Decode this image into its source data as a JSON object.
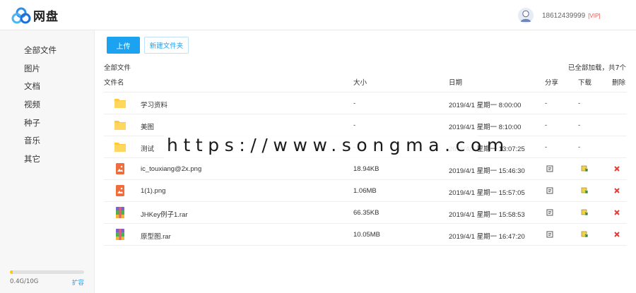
{
  "app": {
    "logo_text": "网盘"
  },
  "user": {
    "phone": "18612439999",
    "vip": "[VIP]"
  },
  "sidebar": {
    "items": [
      {
        "label": "全部文件"
      },
      {
        "label": "图片"
      },
      {
        "label": "文档"
      },
      {
        "label": "视频"
      },
      {
        "label": "种子"
      },
      {
        "label": "音乐"
      },
      {
        "label": "其它"
      }
    ],
    "storage": {
      "text": "0.4G/10G",
      "used_fraction": 0.04,
      "expand_label": "扩容"
    }
  },
  "toolbar": {
    "upload_label": "上传",
    "new_folder_label": "新建文件夹"
  },
  "breadcrumb": "全部文件",
  "status": "已全部加载，共7个",
  "table": {
    "headers": {
      "name": "文件名",
      "size": "大小",
      "date": "日期",
      "share": "分享",
      "download": "下载",
      "delete": "删除"
    },
    "rows": [
      {
        "type": "folder",
        "name": "学习资料",
        "size": "-",
        "date": "2019/4/1 星期一 8:00:00",
        "share": "-",
        "download": "-"
      },
      {
        "type": "folder",
        "name": "美图",
        "size": "-",
        "date": "2019/4/1 星期一 8:10:00",
        "share": "-",
        "download": "-"
      },
      {
        "type": "folder",
        "name": "测试",
        "size": "-",
        "date": "2019/4/1 星期一 13:07:25",
        "share": "-",
        "download": "-"
      },
      {
        "type": "image",
        "name": "ic_touxiang@2x.png",
        "size": "18.94KB",
        "date": "2019/4/1 星期一 15:46:30"
      },
      {
        "type": "image",
        "name": "1(1).png",
        "size": "1.06MB",
        "date": "2019/4/1 星期一 15:57:05"
      },
      {
        "type": "archive",
        "name": "JHKey例子1.rar",
        "size": "66.35KB",
        "date": "2019/4/1 星期一 15:58:53"
      },
      {
        "type": "archive",
        "name": "原型图.rar",
        "size": "10.05MB",
        "date": "2019/4/1 星期一 16:47:20"
      }
    ]
  },
  "watermark": "https://www.songma.com",
  "colors": {
    "accent": "#1ba2f0",
    "folder": "#ffc93c",
    "image_file": "#f26b3a",
    "delete": "#e53935",
    "storage_bar": "#ffcc00"
  }
}
